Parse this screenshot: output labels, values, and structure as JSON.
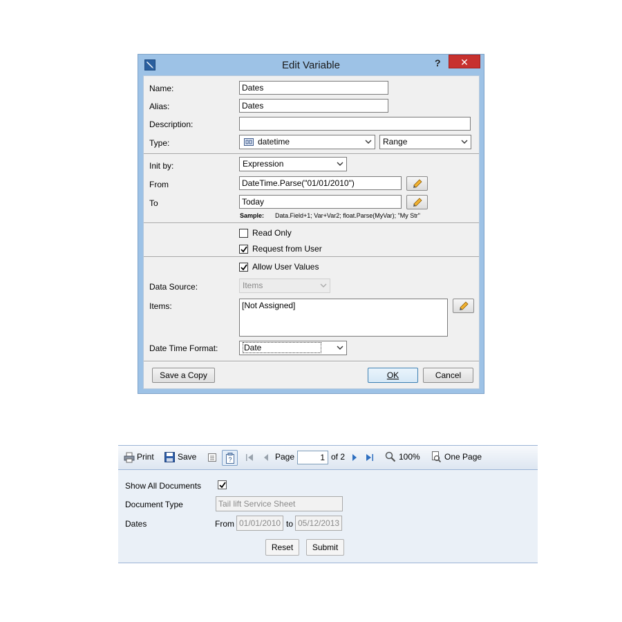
{
  "dialog": {
    "title": "Edit Variable",
    "help": "?",
    "close": "✕",
    "name_label": "Name:",
    "name_value": "Dates",
    "alias_label": "Alias:",
    "alias_value": "Dates",
    "description_label": "Description:",
    "description_value": "",
    "type_label": "Type:",
    "type_value": "datetime",
    "type_mode": "Range",
    "init_label": "Init by:",
    "init_value": "Expression",
    "from_label": "From",
    "from_value": "DateTime.Parse(\"01/01/2010\")",
    "to_label": "To",
    "to_value": "Today",
    "sample_label": "Sample:",
    "sample_text": "Data.Field+1; Var+Var2; float.Parse(MyVar); \"My Str\"",
    "read_only_label": "Read Only",
    "read_only_checked": false,
    "request_label": "Request from User",
    "request_checked": true,
    "allow_label": "Allow User Values",
    "allow_checked": true,
    "datasource_label": "Data Source:",
    "datasource_value": "Items",
    "items_label": "Items:",
    "items_value": "[Not Assigned]",
    "dtformat_label": "Date Time Format:",
    "dtformat_value": "Date",
    "save_copy": "Save a Copy",
    "ok": "OK",
    "cancel": "Cancel"
  },
  "viewer": {
    "toolbar": {
      "print": "Print",
      "save": "Save",
      "page_label": "Page",
      "page_value": "1",
      "of_pages": "of 2",
      "zoom": "100%",
      "view_mode": "One Page"
    },
    "form": {
      "show_all_label": "Show All Documents",
      "show_all_checked": true,
      "doc_type_label": "Document Type",
      "doc_type_value": "Tail lift Service Sheet",
      "dates_label": "Dates",
      "from_label": "From",
      "from_value": "01/01/2010",
      "to_label": "to",
      "to_value": "05/12/2013",
      "reset": "Reset",
      "submit": "Submit"
    }
  }
}
